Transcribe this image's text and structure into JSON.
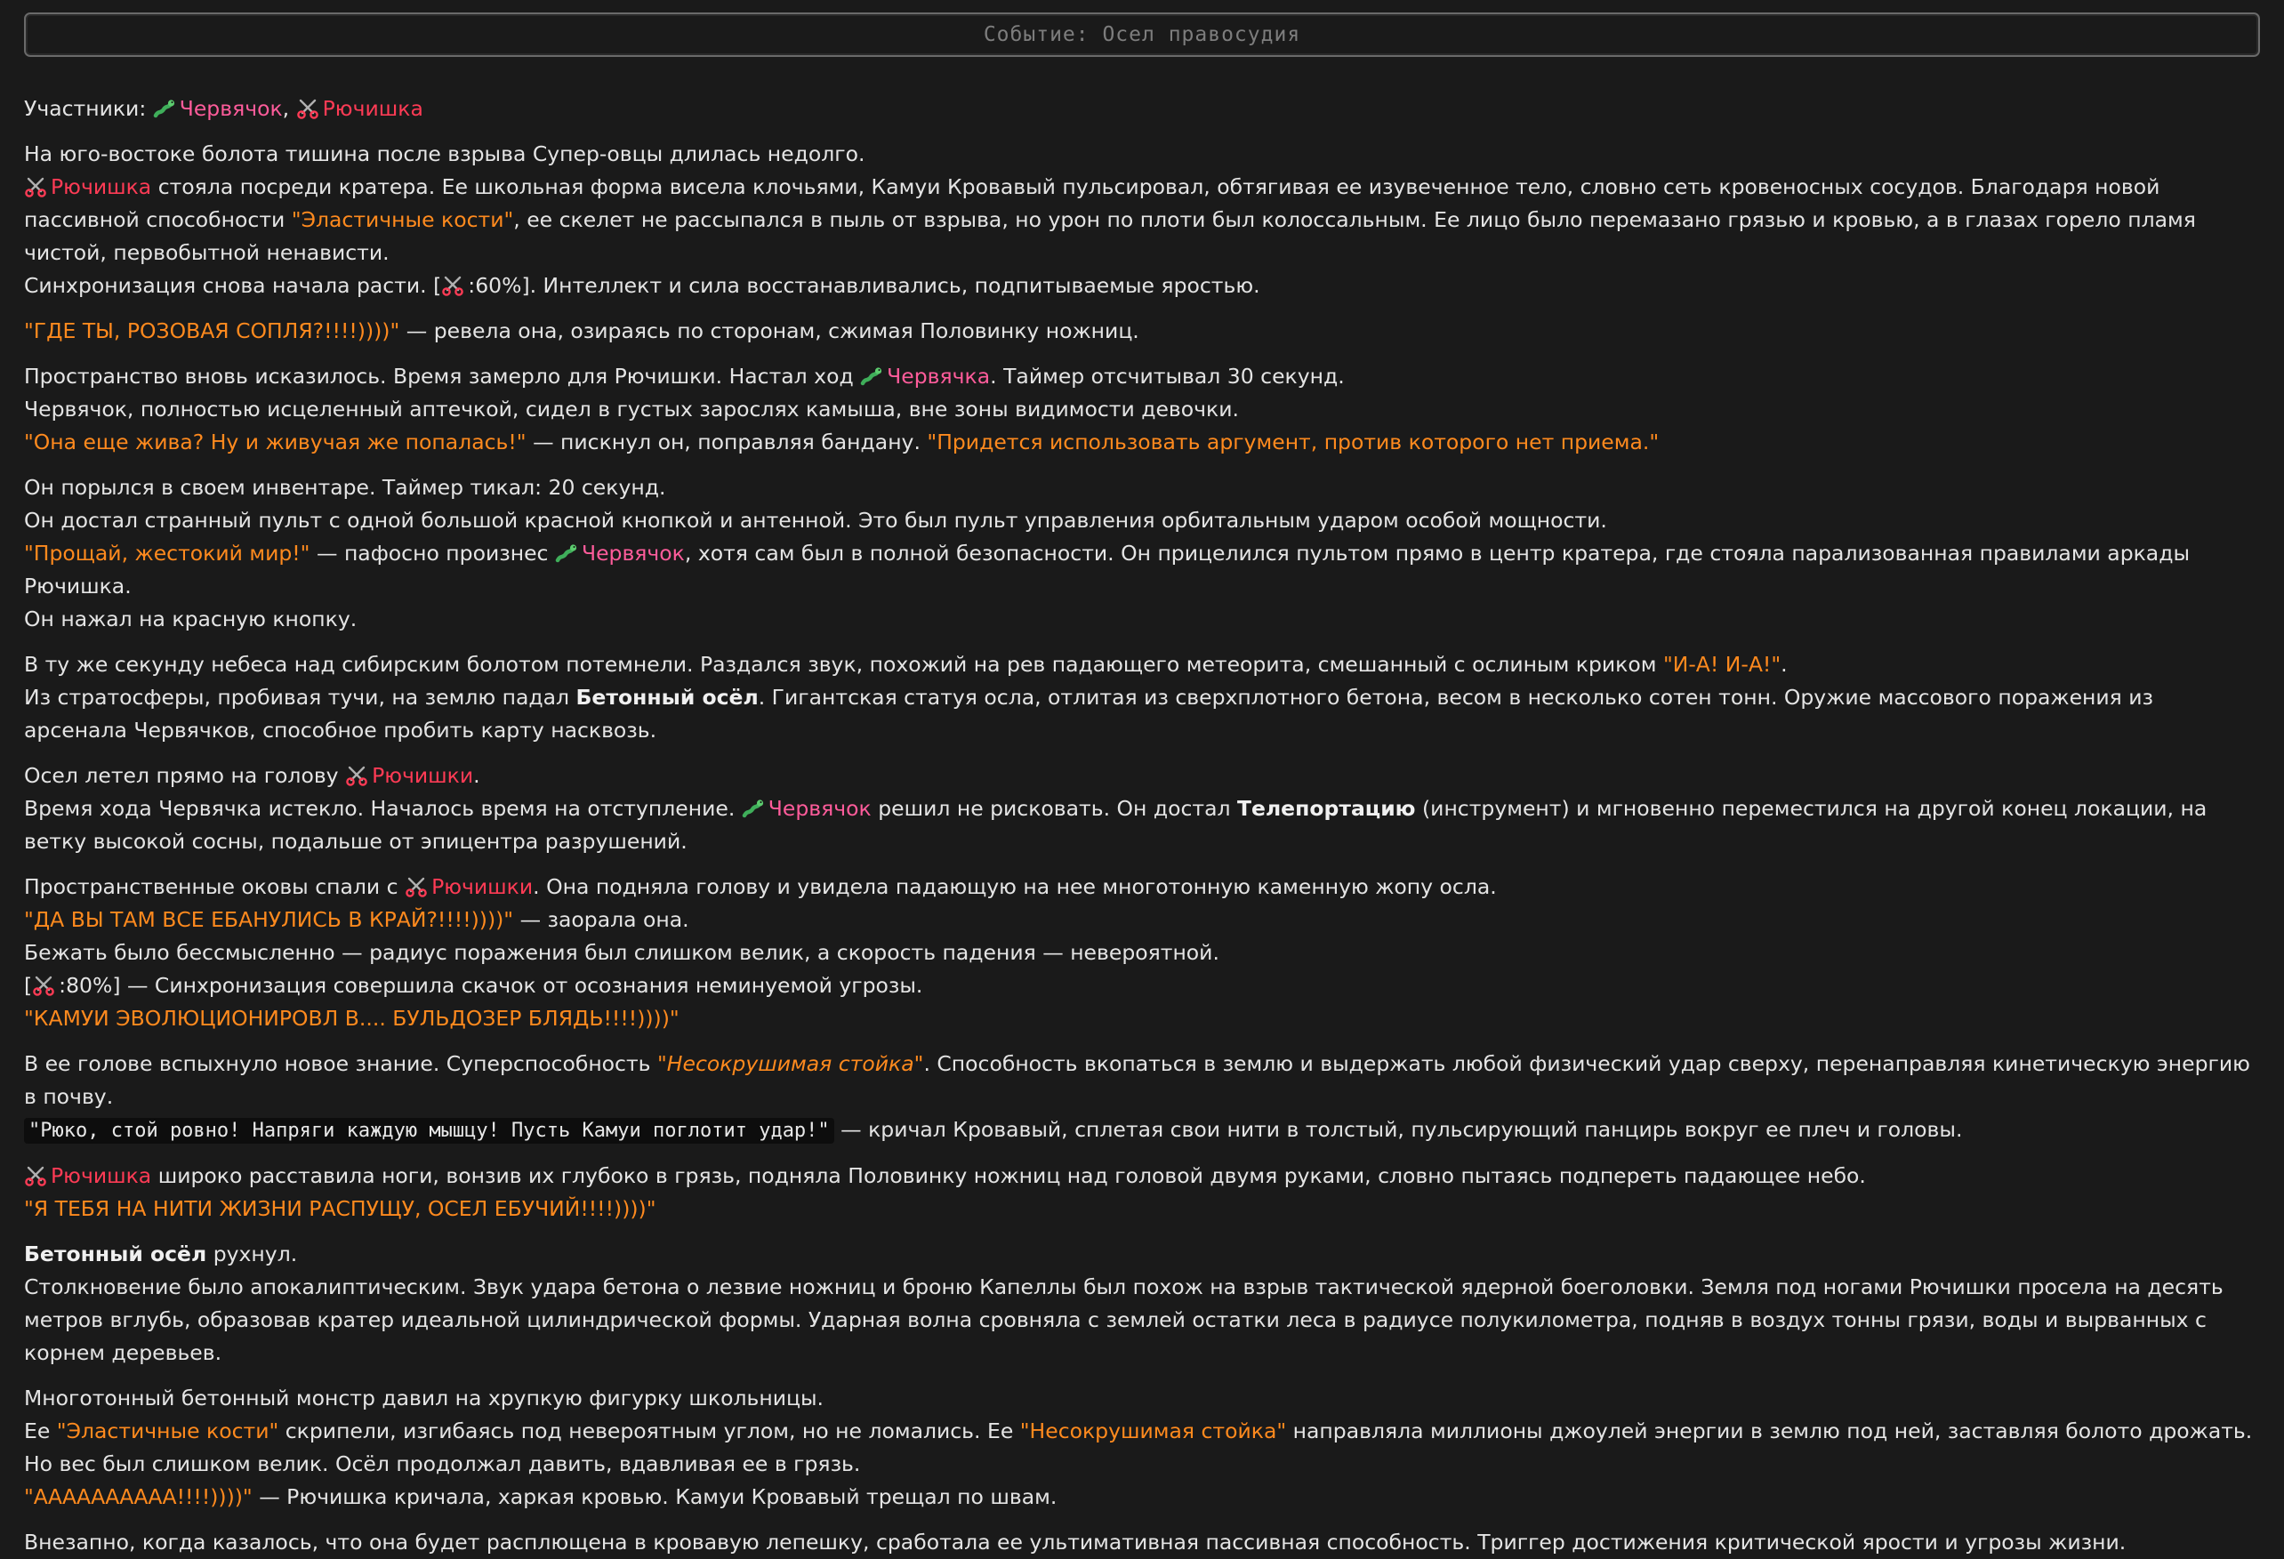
{
  "header": {
    "title": "Событие: Осел правосудия"
  },
  "participants": {
    "label": "Участники:",
    "worm": "Червячок",
    "sep": ",",
    "ryu": "Рючишка"
  },
  "p1": {
    "l1": "На юго-востоке болота тишина после взрыва Супер-овцы длилась недолго.",
    "l2_name": "Рючишка",
    "l2a": " стояла посреди кратера. Ее школьная форма висела клочьями, Камуи Кровавый пульсировал, обтягивая ее изувеченное тело, словно сеть кровеносных сосудов. Благодаря новой пассивной способности ",
    "l2q": "\"Эластичные кости\"",
    "l2b": ", ее скелет не рассыпался в пыль от взрыва, но урон по плоти был колоссальным. Ее лицо было перемазано грязью и кровью, а в глазах горело пламя чистой, первобытной ненависти.",
    "l3a": "Синхронизация снова начала расти. [",
    "l3b": ":60%]. Интеллект и сила восстанавливались, подпитываемые яростью."
  },
  "p2": {
    "q": "\"ГДЕ ТЫ, РОЗОВАЯ СОПЛЯ?!!!!))))\"",
    "t": " — ревела она, озираясь по сторонам, сжимая Половинку ножниц."
  },
  "p3": {
    "l1a": "Пространство вновь исказилось. Время замерло для Рючишки. Настал ход ",
    "l1n": "Червячка",
    "l1b": ". Таймер отсчитывал 30 секунд.",
    "l2": "Червячок, полностью исцеленный аптечкой, сидел в густых зарослях камыша, вне зоны видимости девочки.",
    "l3q1": "\"Она еще жива? Ну и живучая же попалась!\"",
    "l3t": " — пискнул он, поправляя бандану. ",
    "l3q2": "\"Придется использовать аргумент, против которого нет приема.\""
  },
  "p4": {
    "l1": "Он порылся в своем инвентаре. Таймер тикал: 20 секунд.",
    "l2": "Он достал странный пульт с одной большой красной кнопкой и антенной. Это был пульт управления орбитальным ударом особой мощности.",
    "l3q": "\"Прощай, жестокий мир!\"",
    "l3a": " — пафосно произнес ",
    "l3n": "Червячок",
    "l3b": ", хотя сам был в полной безопасности. Он прицелился пультом прямо в центр кратера, где стояла парализованная правилами аркады Рючишка.",
    "l4": "Он нажал на красную кнопку."
  },
  "p5": {
    "l1a": "В ту же секунду небеса над сибирским болотом потемнели. Раздался звук, похожий на рев падающего метеорита, смешанный с ослиным криком ",
    "l1q": "\"И-А! И-А!\"",
    "l1b": ".",
    "l2a": "Из стратосферы, пробивая тучи, на землю падал ",
    "l2bold": "Бетонный осёл",
    "l2b": ". Гигантская статуя осла, отлитая из сверхплотного бетона, весом в несколько сотен тонн. Оружие массового поражения из арсенала Червячков, способное пробить карту насквозь."
  },
  "p6": {
    "l1a": "Осел летел прямо на голову ",
    "l1n": "Рючишки",
    "l1b": ".",
    "l2a": "Время хода Червячка истекло. Началось время на отступление. ",
    "l2n": "Червячок",
    "l2b": " решил не рисковать. Он достал ",
    "l2bold": "Телепортацию",
    "l2c": " (инструмент) и мгновенно переместился на другой конец локации, на ветку высокой сосны, подальше от эпицентра разрушений."
  },
  "p7": {
    "l1a": "Пространственные оковы спали с ",
    "l1n": "Рючишки",
    "l1b": ". Она подняла голову и увидела падающую на нее многотонную каменную жопу осла.",
    "l2q": "\"ДА ВЫ ТАМ ВСЕ ЕБАНУЛИСЬ В КРАЙ?!!!!))))\"",
    "l2t": " — заорала она.",
    "l3": "Бежать было бессмысленно — радиус поражения был слишком велик, а скорость падения — невероятной.",
    "l4a": "[",
    "l4b": ":80%] — Синхронизация совершила скачок от осознания неминуемой угрозы.",
    "l5q": "\"КАМУИ ЭВОЛЮЦИОНИРОВЛ В.... БУЛЬДОЗЕР БЛЯДЬ!!!!))))\""
  },
  "p8": {
    "l1a": "В ее голове вспыхнуло новое знание. Суперспособность ",
    "l1q": "\"Несокрушимая стойка\"",
    "l1b": ". Способность вкопаться в землю и выдержать любой физический удар сверху, перенаправляя кинетическую энергию в почву.",
    "l2code": "\"Рюко, стой ровно! Напряги каждую мышцу! Пусть Камуи поглотит удар!\"",
    "l2t": " — кричал Кровавый, сплетая свои нити в толстый, пульсирующий панцирь вокруг ее плеч и головы."
  },
  "p9": {
    "l1n": "Рючишка",
    "l1t": " широко расставила ноги, вонзив их глубоко в грязь, подняла Половинку ножниц над головой двумя руками, словно пытаясь подпереть падающее небо.",
    "l2q": "\"Я ТЕБЯ НА НИТИ ЖИЗНИ РАСПУЩУ, ОСЕЛ ЕБУЧИЙ!!!!))))\""
  },
  "p10": {
    "l1bold": "Бетонный осёл",
    "l1t": " рухнул.",
    "l2": "Столкновение было апокалиптическим. Звук удара бетона о лезвие ножниц и броню Капеллы был похож на взрыв тактической ядерной боеголовки. Земля под ногами Рючишки просела на десять метров вглубь, образовав кратер идеальной цилиндрической формы. Ударная волна сровняла с землей остатки леса в радиусе полукилометра, подняв в воздух тонны грязи, воды и вырванных с корнем деревьев."
  },
  "p11": {
    "l1": "Многотонный бетонный монстр давил на хрупкую фигурку школьницы.",
    "l2a": "Ее ",
    "l2q1": "\"Эластичные кости\"",
    "l2b": " скрипели, изгибаясь под невероятным углом, но не ломались. Ее ",
    "l2q2": "\"Несокрушимая стойка\"",
    "l2c": " направляла миллионы джоулей энергии в землю под ней, заставляя болото дрожать.",
    "l3": "Но вес был слишком велик. Осёл продолжал давить, вдавливая ее в грязь.",
    "l4q": "\"АААААААААА!!!!))))\"",
    "l4t": " — Рючишка кричала, харкая кровью. Камуи Кровавый трещал по швам."
  },
  "p12": {
    "l1": "Внезапно, когда казалось, что она будет расплющена в кровавую лепешку, сработала ее ультимативная пассивная способность. Триггер достижения критической ярости и угрозы жизни."
  },
  "icons": {
    "worm": "worm-icon",
    "ryu": "scissors-icon"
  },
  "colors": {
    "background": "#1a1a1a",
    "text": "#e4e4e4",
    "worm": "#ff5c9b",
    "ryu": "#ff3b55",
    "quote": "#ff8a1e"
  }
}
